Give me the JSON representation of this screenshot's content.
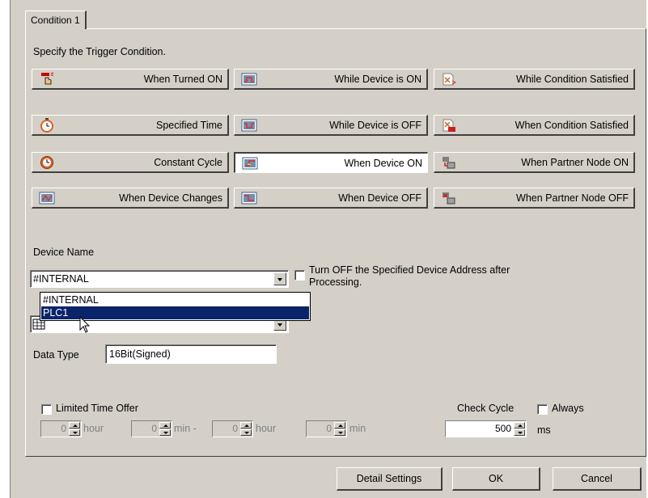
{
  "tab": {
    "label": "Condition 1"
  },
  "instruction": "Specify the Trigger Condition.",
  "trigger_buttons": [
    {
      "label": "When Turned ON",
      "icon": "hand-touch-icon"
    },
    {
      "label": "While Device is ON",
      "icon": "device-on-icon"
    },
    {
      "label": "While Condition Satisfied",
      "icon": "condition-icon"
    },
    {
      "label": "Specified Time",
      "icon": "stopwatch-icon"
    },
    {
      "label": "While Device is OFF",
      "icon": "device-off-icon"
    },
    {
      "label": "When Condition Satisfied",
      "icon": "condition-ok-icon"
    },
    {
      "label": "Constant Cycle",
      "icon": "cycle-clock-icon"
    },
    {
      "label": "When Device ON",
      "icon": "device-rise-icon"
    },
    {
      "label": "When Partner Node ON",
      "icon": "partner-node-on-icon"
    },
    {
      "label": "When Device Changes",
      "icon": "device-change-icon"
    },
    {
      "label": "When Device OFF",
      "icon": "device-fall-icon"
    },
    {
      "label": "When Partner Node OFF",
      "icon": "partner-node-off-icon"
    }
  ],
  "selected_trigger": "When Device ON",
  "device_name": {
    "label": "Device Name",
    "value": "#INTERNAL",
    "options": [
      "#INTERNAL",
      "PLC1"
    ],
    "highlighted": "PLC1"
  },
  "turn_off_option": {
    "label_line1": "Turn OFF the Specified Device Address after",
    "label_line2": "Processing.",
    "checked": false
  },
  "data_type": {
    "label": "Data Type",
    "value": "16Bit(Signed)"
  },
  "limited_time": {
    "label": "Limited Time Offer",
    "checked": false,
    "start_hour": "0",
    "hour_label": "hour",
    "start_min": "0",
    "min_dash_label": "min -",
    "end_hour": "0",
    "end_min": "0",
    "min_label": "min"
  },
  "check_cycle": {
    "label": "Check Cycle",
    "always_label": "Always",
    "always_checked": false,
    "value": "500",
    "unit": "ms"
  },
  "footer": {
    "detail_settings": "Detail Settings",
    "ok": "OK",
    "cancel": "Cancel"
  },
  "colors": {
    "face": "#d4d0c8",
    "highlight": "#0a246a"
  }
}
